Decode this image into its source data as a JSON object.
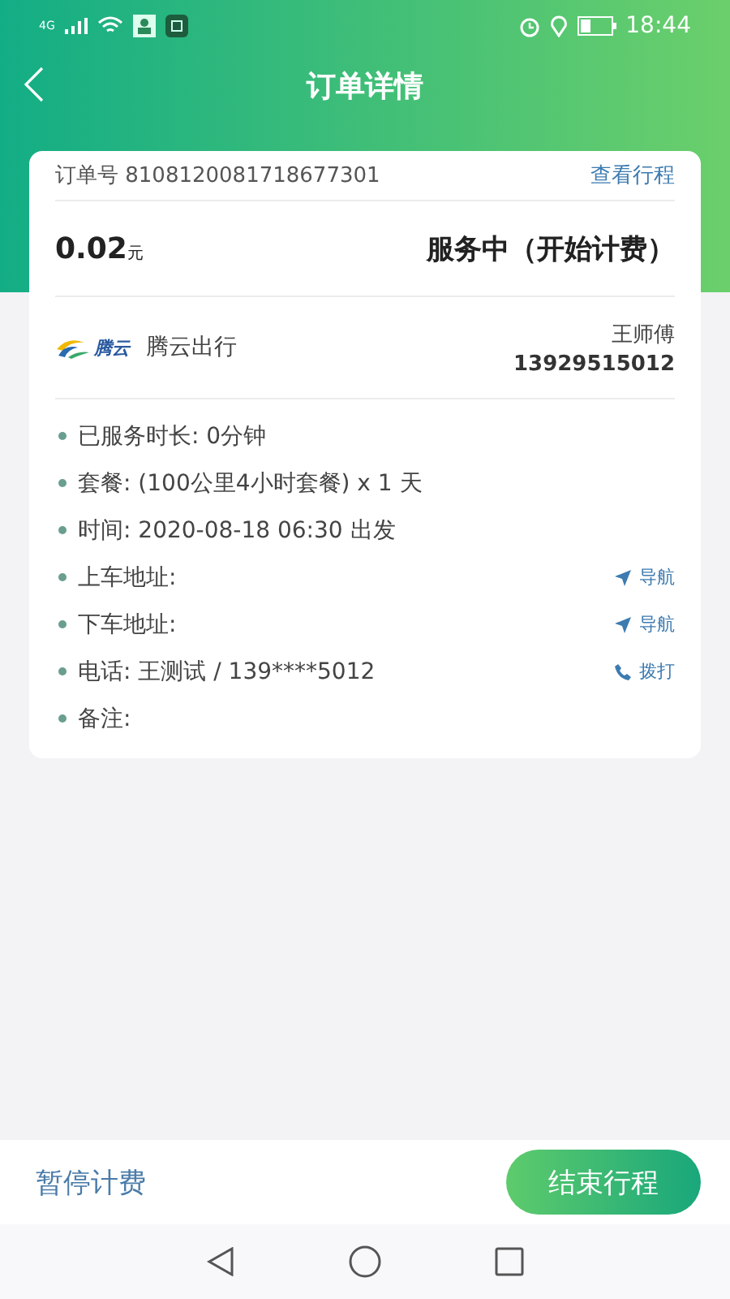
{
  "status_bar": {
    "time": "18:44",
    "network": "4G"
  },
  "header": {
    "title": "订单详情"
  },
  "order": {
    "number_label": "订单号",
    "number": "8108120081718677301",
    "view_link": "查看行程",
    "price": "0.02",
    "unit": "元",
    "status": "服务中（开始计费）"
  },
  "company": {
    "logo_text": "腾云",
    "name": "腾云出行",
    "driver": "王师傅",
    "driver_phone": "13929515012"
  },
  "details": [
    {
      "text": "已服务时长: 0分钟"
    },
    {
      "text": "套餐: (100公里4小时套餐) x 1 天"
    },
    {
      "text": "时间: 2020-08-18 06:30 出发"
    },
    {
      "text": "上车地址:",
      "action": {
        "kind": "navigate",
        "label": "导航"
      }
    },
    {
      "text": "下车地址:",
      "action": {
        "kind": "navigate",
        "label": "导航"
      }
    },
    {
      "text": "电话: 王测试 / 139****5012",
      "action": {
        "kind": "call",
        "label": "拨打"
      }
    },
    {
      "text": "备注:"
    }
  ],
  "footer": {
    "pause": "暂停计费",
    "end": "结束行程"
  }
}
